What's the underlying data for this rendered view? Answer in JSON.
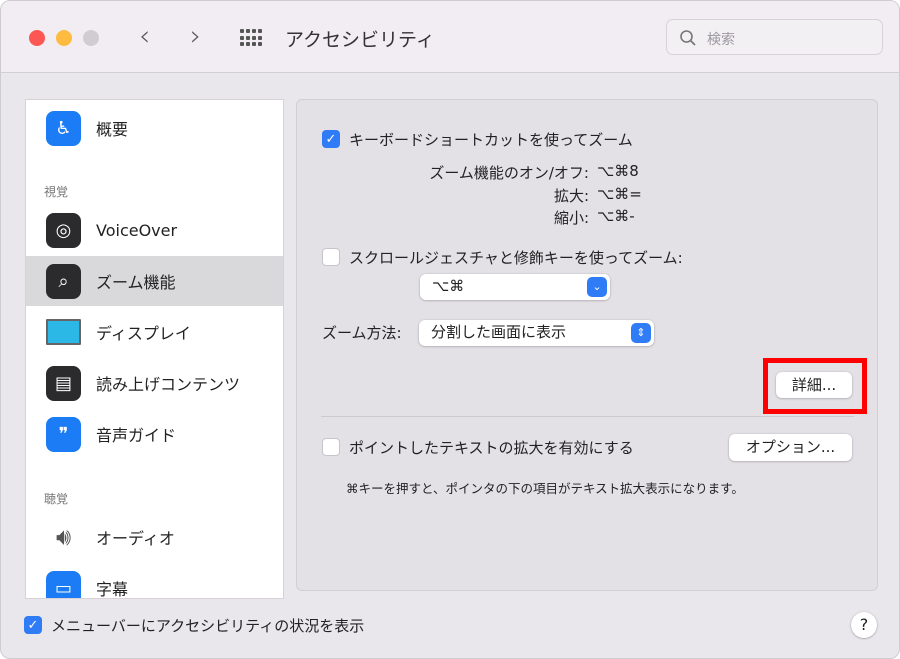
{
  "window": {
    "title": "アクセシビリティ",
    "search_placeholder": "検索",
    "back": "‹",
    "forward": "›"
  },
  "sidebar": {
    "items": [
      {
        "label": "概要",
        "icon": "accessibility-icon"
      },
      {
        "section": "視覚"
      },
      {
        "label": "VoiceOver",
        "icon": "voiceover-icon"
      },
      {
        "label": "ズーム機能",
        "icon": "zoom-icon",
        "selected": true
      },
      {
        "label": "ディスプレイ",
        "icon": "display-icon"
      },
      {
        "label": "読み上げコンテンツ",
        "icon": "spoken-content-icon"
      },
      {
        "label": "音声ガイド",
        "icon": "descriptions-icon"
      },
      {
        "section": "聴覚"
      },
      {
        "label": "オーディオ",
        "icon": "speaker-icon"
      },
      {
        "label": "字幕",
        "icon": "captions-icon"
      }
    ]
  },
  "zoom": {
    "keyboard_shortcut": {
      "label": "キーボードショートカットを使ってズーム",
      "checked": true
    },
    "shortcuts": [
      {
        "name": "ズーム機能のオン/オフ:",
        "keys": "⌥⌘8"
      },
      {
        "name": "拡大:",
        "keys": "⌥⌘="
      },
      {
        "name": "縮小:",
        "keys": "⌥⌘-"
      }
    ],
    "scroll_gesture": {
      "label": "スクロールジェスチャと修飾キーを使ってズーム:",
      "checked": false,
      "modifier": "⌥⌘"
    },
    "zoom_style": {
      "label": "ズーム方法:",
      "value": "分割した画面に表示"
    },
    "advanced_button": "詳細...",
    "hover_text": {
      "label": "ポイントしたテキストの拡大を有効にする",
      "checked": false,
      "options_button": "オプション...",
      "hint": "⌘キーを押すと、ポインタの下の項目がテキスト拡大表示になります。"
    }
  },
  "footer": {
    "menubar_status": {
      "label": "メニューバーにアクセシビリティの状況を表示",
      "checked": true
    },
    "help": "?"
  }
}
